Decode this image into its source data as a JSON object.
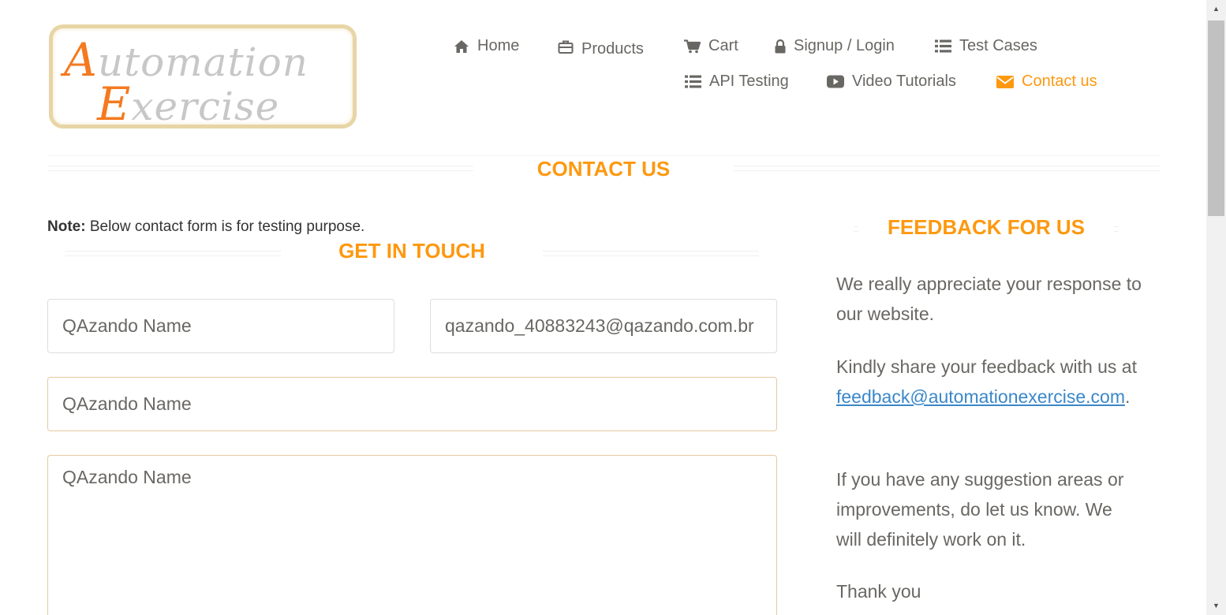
{
  "logo": {
    "line1_cap": "A",
    "line1_rest": "utomation",
    "line2_cap": "E",
    "line2_rest": "xercise"
  },
  "nav": {
    "home": "Home",
    "products": "Products",
    "cart": "Cart",
    "signup_login": "Signup / Login",
    "test_cases": "Test Cases",
    "api_testing": "API Testing",
    "video_tutorials": "Video Tutorials",
    "contact_us": "Contact us",
    "active": "contact_us",
    "icons": {
      "home": "home-icon",
      "products": "briefcase-icon",
      "cart": "cart-icon",
      "signup_login": "lock-icon",
      "test_cases": "list-icon",
      "api_testing": "list-icon",
      "video_tutorials": "youtube-play-icon",
      "contact_us": "envelope-icon"
    }
  },
  "colors": {
    "accent": "#FE980F",
    "text": "#696763",
    "link": "#3A87C9",
    "logo_orange": "#F47A20"
  },
  "contact": {
    "title": "CONTACT US",
    "note_label": "Note:",
    "note_text": " Below contact form is for testing purpose.",
    "form_title": "GET IN TOUCH",
    "name_value": "QAzando Name",
    "email_value": "qazando_40883243@qazando.com.br",
    "subject_value": "QAzando Name",
    "message_value": "QAzando Name"
  },
  "feedback": {
    "title": "FEEDBACK FOR US",
    "p1": "We really appreciate your response to our website.",
    "p2_text": "Kindly share your feedback with us at",
    "p2_link": "feedback@automationexercise.com",
    "p2_end": ".",
    "p3": "If you have any suggestion areas or improvements, do let us know. We will definitely work on it.",
    "p4": "Thank you"
  }
}
